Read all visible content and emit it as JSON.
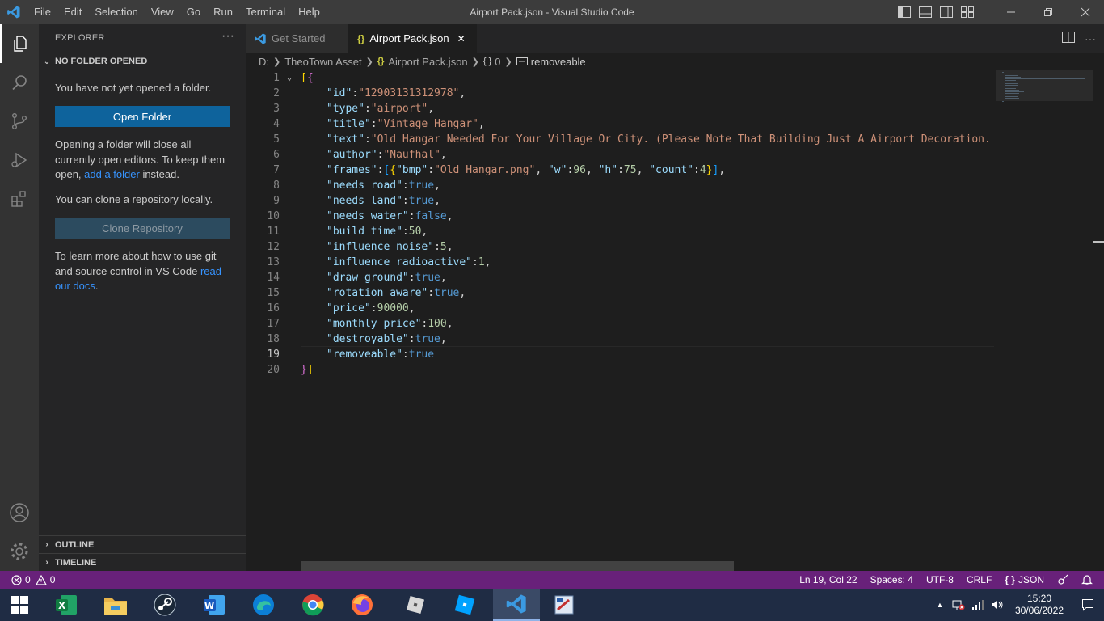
{
  "window": {
    "title": "Airport Pack.json - Visual Studio Code",
    "menu": [
      "File",
      "Edit",
      "Selection",
      "View",
      "Go",
      "Run",
      "Terminal",
      "Help"
    ]
  },
  "sidebar": {
    "title": "EXPLORER",
    "more": "···",
    "section_title": "NO FOLDER OPENED",
    "no_folder_text": "You have not yet opened a folder.",
    "open_folder_label": "Open Folder",
    "opening_text_before": "Opening a folder will close all currently open editors. To keep them open, ",
    "add_folder_link": "add a folder",
    "opening_text_after": " instead.",
    "clone_text": "You can clone a repository locally.",
    "clone_label": "Clone Repository",
    "learn_text_before": "To learn more about how to use git and source control in VS Code ",
    "read_docs_link": "read our docs",
    "learn_text_after": ".",
    "outline_label": "OUTLINE",
    "timeline_label": "TIMELINE"
  },
  "tabs": {
    "get_started": "Get Started",
    "airport_pack": "Airport Pack.json",
    "close_glyph": "✕"
  },
  "breadcrumb": {
    "drive": "D:",
    "folder": "TheoTown Asset",
    "file": "Airport Pack.json",
    "index": "0",
    "index_icon": "{ }",
    "property": "removeable"
  },
  "editor": {
    "lines": [
      {
        "n": "1",
        "segs": [
          [
            "br1",
            "["
          ],
          [
            "br2",
            "{"
          ]
        ],
        "fold": true
      },
      {
        "n": "2",
        "segs": [
          [
            "k",
            "\"id\""
          ],
          [
            "p",
            ":"
          ],
          [
            "s",
            "\"12903131312978\""
          ],
          [
            "p",
            ","
          ]
        ]
      },
      {
        "n": "3",
        "segs": [
          [
            "k",
            "\"type\""
          ],
          [
            "p",
            ":"
          ],
          [
            "s",
            "\"airport\""
          ],
          [
            "p",
            ","
          ]
        ]
      },
      {
        "n": "4",
        "segs": [
          [
            "k",
            "\"title\""
          ],
          [
            "p",
            ":"
          ],
          [
            "s",
            "\"Vintage Hangar\""
          ],
          [
            "p",
            ","
          ]
        ]
      },
      {
        "n": "5",
        "segs": [
          [
            "k",
            "\"text\""
          ],
          [
            "p",
            ":"
          ],
          [
            "s",
            "\"Old Hangar Needed For Your Village Or City. (Please Note That Building Just A Airport Decoration. Bu"
          ]
        ]
      },
      {
        "n": "6",
        "segs": [
          [
            "k",
            "\"author\""
          ],
          [
            "p",
            ":"
          ],
          [
            "s",
            "\"Naufhal\""
          ],
          [
            "p",
            ","
          ]
        ]
      },
      {
        "n": "7",
        "segs": [
          [
            "k",
            "\"frames\""
          ],
          [
            "p",
            ":"
          ],
          [
            "br3",
            "["
          ],
          [
            "br1",
            "{"
          ],
          [
            "k",
            "\"bmp\""
          ],
          [
            "p",
            ":"
          ],
          [
            "s",
            "\"Old Hangar.png\""
          ],
          [
            "p",
            ", "
          ],
          [
            "k",
            "\"w\""
          ],
          [
            "p",
            ":"
          ],
          [
            "n",
            "96"
          ],
          [
            "p",
            ", "
          ],
          [
            "k",
            "\"h\""
          ],
          [
            "p",
            ":"
          ],
          [
            "n",
            "75"
          ],
          [
            "p",
            ", "
          ],
          [
            "k",
            "\"count\""
          ],
          [
            "p",
            ":"
          ],
          [
            "n",
            "4"
          ],
          [
            "br1",
            "}"
          ],
          [
            "br3",
            "]"
          ],
          [
            "p",
            ","
          ]
        ]
      },
      {
        "n": "8",
        "segs": [
          [
            "k",
            "\"needs road\""
          ],
          [
            "p",
            ":"
          ],
          [
            "b",
            "true"
          ],
          [
            "p",
            ","
          ]
        ]
      },
      {
        "n": "9",
        "segs": [
          [
            "k",
            "\"needs land\""
          ],
          [
            "p",
            ":"
          ],
          [
            "b",
            "true"
          ],
          [
            "p",
            ","
          ]
        ]
      },
      {
        "n": "10",
        "segs": [
          [
            "k",
            "\"needs water\""
          ],
          [
            "p",
            ":"
          ],
          [
            "b",
            "false"
          ],
          [
            "p",
            ","
          ]
        ]
      },
      {
        "n": "11",
        "segs": [
          [
            "k",
            "\"build time\""
          ],
          [
            "p",
            ":"
          ],
          [
            "n",
            "50"
          ],
          [
            "p",
            ","
          ]
        ]
      },
      {
        "n": "12",
        "segs": [
          [
            "k",
            "\"influence noise\""
          ],
          [
            "p",
            ":"
          ],
          [
            "n",
            "5"
          ],
          [
            "p",
            ","
          ]
        ]
      },
      {
        "n": "13",
        "segs": [
          [
            "k",
            "\"influence radioactive\""
          ],
          [
            "p",
            ":"
          ],
          [
            "n",
            "1"
          ],
          [
            "p",
            ","
          ]
        ]
      },
      {
        "n": "14",
        "segs": [
          [
            "k",
            "\"draw ground\""
          ],
          [
            "p",
            ":"
          ],
          [
            "b",
            "true"
          ],
          [
            "p",
            ","
          ]
        ]
      },
      {
        "n": "15",
        "segs": [
          [
            "k",
            "\"rotation aware\""
          ],
          [
            "p",
            ":"
          ],
          [
            "b",
            "true"
          ],
          [
            "p",
            ","
          ]
        ]
      },
      {
        "n": "16",
        "segs": [
          [
            "k",
            "\"price\""
          ],
          [
            "p",
            ":"
          ],
          [
            "n",
            "90000"
          ],
          [
            "p",
            ","
          ]
        ]
      },
      {
        "n": "17",
        "segs": [
          [
            "k",
            "\"monthly price\""
          ],
          [
            "p",
            ":"
          ],
          [
            "n",
            "100"
          ],
          [
            "p",
            ","
          ]
        ]
      },
      {
        "n": "18",
        "segs": [
          [
            "k",
            "\"destroyable\""
          ],
          [
            "p",
            ":"
          ],
          [
            "b",
            "true"
          ],
          [
            "p",
            ","
          ]
        ]
      },
      {
        "n": "19",
        "segs": [
          [
            "k",
            "\"removeable\""
          ],
          [
            "p",
            ":"
          ],
          [
            "b",
            "true"
          ]
        ],
        "current": true
      },
      {
        "n": "20",
        "segs": [
          [
            "br2",
            "}"
          ],
          [
            "br1",
            "]"
          ]
        ]
      }
    ]
  },
  "statusbar": {
    "errors": "0",
    "warnings": "0",
    "position": "Ln 19, Col 22",
    "spaces": "Spaces: 4",
    "encoding": "UTF-8",
    "eol": "CRLF",
    "language": "JSON",
    "language_icon": "{ }"
  },
  "taskbar": {
    "time": "15:20",
    "date": "30/06/2022",
    "apps": [
      "start-icon",
      "excel-icon",
      "file-explorer-icon",
      "steam-icon",
      "word-icon",
      "edge-icon",
      "chrome-icon",
      "firefox-icon",
      "roblox-icon",
      "roblox-studio-icon",
      "vscode-icon",
      "paint-icon"
    ]
  },
  "colors": {
    "statusbar": "#68217a",
    "button": "#0e639c",
    "taskbar": "#1f2c44"
  }
}
